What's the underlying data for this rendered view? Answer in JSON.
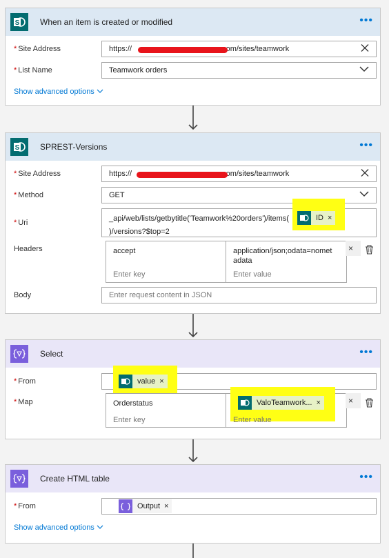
{
  "cards": {
    "trigger": {
      "title": "When an item is created or modified",
      "site_label": "Site Address",
      "site_prefix": "https://",
      "site_suffix": ".com/sites/teamwork",
      "list_label": "List Name",
      "list_value": "Teamwork orders",
      "advanced": "Show advanced options"
    },
    "sprest": {
      "title": "SPREST-Versions",
      "site_label": "Site Address",
      "site_prefix": "https://",
      "site_suffix": ".com/sites/teamwork",
      "method_label": "Method",
      "method_value": "GET",
      "uri_label": "Uri",
      "uri_line1": "_api/web/lists/getbytitle('Teamwork%20orders')/items(",
      "uri_token": "ID",
      "uri_line2": ")/versions?$top=2",
      "headers_label": "Headers",
      "header_key": "accept",
      "header_value_line1": "application/json;odata=nomet",
      "header_value_line2": "adata",
      "key_placeholder": "Enter key",
      "value_placeholder": "Enter value",
      "body_label": "Body",
      "body_placeholder": "Enter request content in JSON"
    },
    "select": {
      "title": "Select",
      "from_label": "From",
      "from_token": "value",
      "map_label": "Map",
      "map_key": "Orderstatus",
      "map_token": "ValoTeamwork...",
      "key_placeholder": "Enter key",
      "value_placeholder": "Enter value"
    },
    "html_table": {
      "title": "Create HTML table",
      "from_label": "From",
      "from_token": "Output",
      "advanced": "Show advanced options"
    }
  },
  "common": {
    "required_mark": "*",
    "more": "•••",
    "token_remove": "×",
    "clear": "×"
  },
  "colors": {
    "sharepoint": "#036c70",
    "data_operation": "#7a5fdc",
    "link": "#0078d4",
    "highlight": "#ffff14",
    "redaction": "#e8141b"
  }
}
